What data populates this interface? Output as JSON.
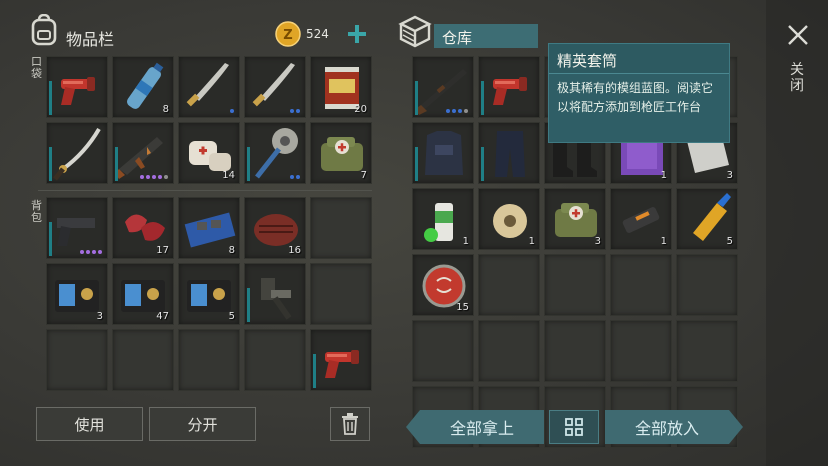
{
  "inventory": {
    "title": "物品栏",
    "coins": "524",
    "pocket_label": "口袋",
    "backpack_label": "背包",
    "pocket_slots": [
      {
        "icon": "flare-gun-icon",
        "count": "",
        "cond": true
      },
      {
        "icon": "water-bottle-icon",
        "count": "8",
        "cond": false
      },
      {
        "icon": "machete-icon",
        "count": "",
        "cond": false,
        "dots": [
          "#3b6fd0"
        ]
      },
      {
        "icon": "machete-icon",
        "count": "",
        "cond": false,
        "dots": [
          "#3b6fd0",
          "#3b6fd0"
        ]
      },
      {
        "icon": "canned-food-icon",
        "count": "20",
        "cond": false
      },
      {
        "icon": "katana-icon",
        "count": "",
        "cond": true
      },
      {
        "icon": "assault-rifle-icon",
        "count": "",
        "cond": true,
        "dots": [
          "#a46ee0",
          "#a46ee0",
          "#a46ee0",
          "#a46ee0",
          "#8f8f8f"
        ]
      },
      {
        "icon": "bandage-icon",
        "count": "14",
        "cond": false
      },
      {
        "icon": "saw-mace-icon",
        "count": "",
        "cond": true,
        "dots": [
          "#3b6fd0",
          "#3b6fd0"
        ]
      },
      {
        "icon": "medkit-bag-icon",
        "count": "7",
        "cond": false
      }
    ],
    "backpack_slots": [
      {
        "icon": "pistol-icon",
        "count": "",
        "cond": true,
        "dots": [
          "#a46ee0",
          "#a46ee0",
          "#a46ee0",
          "#a46ee0"
        ]
      },
      {
        "icon": "raw-meat-icon",
        "count": "17",
        "cond": false
      },
      {
        "icon": "circuit-board-icon",
        "count": "8",
        "cond": false
      },
      {
        "icon": "steak-icon",
        "count": "16",
        "cond": false
      },
      {
        "icon": "",
        "count": "",
        "cond": false
      },
      {
        "icon": "id-wallet-icon",
        "count": "3",
        "cond": false
      },
      {
        "icon": "id-wallet-icon",
        "count": "47",
        "cond": false
      },
      {
        "icon": "id-wallet-icon",
        "count": "5",
        "cond": false
      },
      {
        "icon": "scope-gadget-icon",
        "count": "",
        "cond": true
      },
      {
        "icon": "",
        "count": "",
        "cond": false
      },
      {
        "icon": "",
        "count": "",
        "cond": false
      },
      {
        "icon": "",
        "count": "",
        "cond": false
      },
      {
        "icon": "",
        "count": "",
        "cond": false
      },
      {
        "icon": "",
        "count": "",
        "cond": false
      },
      {
        "icon": "flare-gun-icon",
        "count": "",
        "cond": true
      }
    ],
    "use_label": "使用",
    "split_label": "分开"
  },
  "storage": {
    "title": "仓库",
    "slots": [
      {
        "icon": "shotgun-icon",
        "count": "",
        "cond": true,
        "dots": [
          "#3b6fd0",
          "#3b6fd0",
          "#3b6fd0",
          "#8f8f8f"
        ]
      },
      {
        "icon": "flare-gun-icon",
        "count": "",
        "cond": true
      },
      {
        "icon": "",
        "count": "",
        "cond": false
      },
      {
        "icon": "",
        "count": "",
        "cond": false
      },
      {
        "icon": "",
        "count": "",
        "cond": false
      },
      {
        "icon": "armor-vest-icon",
        "count": "",
        "cond": true
      },
      {
        "icon": "armor-pants-icon",
        "count": "",
        "cond": true
      },
      {
        "icon": "boots-icon",
        "count": "",
        "cond": false
      },
      {
        "icon": "blueprint-icon",
        "count": "1",
        "cond": false
      },
      {
        "icon": "metal-sheet-icon",
        "count": "3",
        "cond": false
      },
      {
        "icon": "spray-can-icon",
        "count": "1",
        "cond": false
      },
      {
        "icon": "wire-spool-icon",
        "count": "1",
        "cond": false
      },
      {
        "icon": "medkit-bag-icon",
        "count": "3",
        "cond": false
      },
      {
        "icon": "usb-drive-icon",
        "count": "1",
        "cond": false
      },
      {
        "icon": "glue-icon",
        "count": "5",
        "cond": false
      },
      {
        "icon": "bottle-cap-icon",
        "count": "15",
        "cond": false
      },
      {
        "icon": "",
        "count": "",
        "cond": false
      },
      {
        "icon": "",
        "count": "",
        "cond": false
      },
      {
        "icon": "",
        "count": "",
        "cond": false
      },
      {
        "icon": "",
        "count": "",
        "cond": false
      },
      {
        "icon": "",
        "count": "",
        "cond": false
      },
      {
        "icon": "",
        "count": "",
        "cond": false
      },
      {
        "icon": "",
        "count": "",
        "cond": false
      },
      {
        "icon": "",
        "count": "",
        "cond": false
      },
      {
        "icon": "",
        "count": "",
        "cond": false
      },
      {
        "icon": "",
        "count": "",
        "cond": false
      },
      {
        "icon": "",
        "count": "",
        "cond": false
      },
      {
        "icon": "",
        "count": "",
        "cond": false
      },
      {
        "icon": "",
        "count": "",
        "cond": false
      },
      {
        "icon": "",
        "count": "",
        "cond": false
      }
    ],
    "take_all_label": "全部拿上",
    "put_all_label": "全部放入"
  },
  "tooltip": {
    "title": "精英套筒",
    "body": "极其稀有的模组蓝图。阅读它以将配方添加到枪匠工作台"
  },
  "close_label": "关闭",
  "colors": {
    "accent": "#3f6a71",
    "condition": "#1f7f86",
    "coin": "#e0a526"
  }
}
